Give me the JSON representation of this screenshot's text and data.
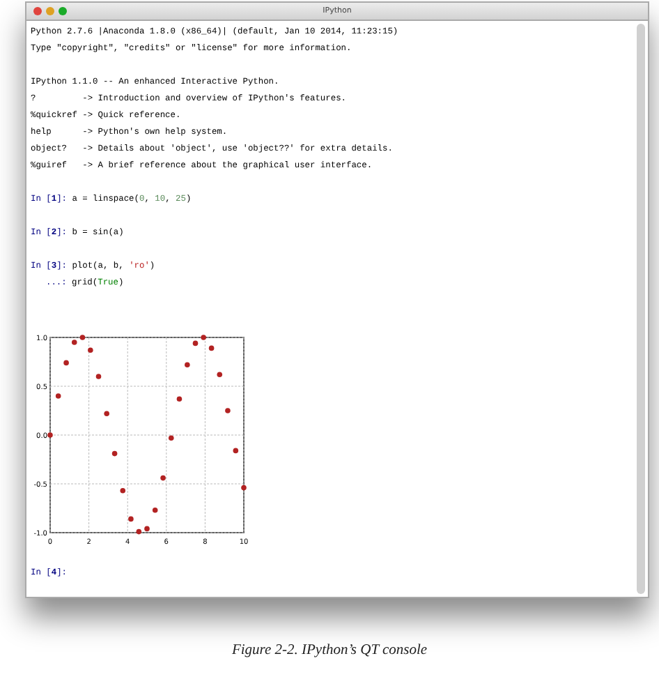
{
  "window": {
    "title": "IPython"
  },
  "banner": [
    [
      "Python 2.7.6 |Anaconda 1.8.0 (x86_64)| (default, Jan 10 2014, 11:23:15)",
      "Type \"copyright\", \"credits\" or \"license\" for more information."
    ],
    [
      "IPython 1.1.0 -- An enhanced Interactive Python.",
      "?         -> Introduction and overview of IPython's features.",
      "%quickref -> Quick reference.",
      "help      -> Python's own help system.",
      "object?   -> Details about 'object', use 'object??' for extra details.",
      "%guiref   -> A brief reference about the graphical user interface."
    ]
  ],
  "cells": [
    {
      "lines": [
        {
          "prompt": "In [**1**]:",
          "kind": "input",
          "code": [
            {
              "t": "a = linspace(",
              "kind": "plain"
            },
            {
              "t": "0",
              "kind": "number"
            },
            {
              "t": ", ",
              "kind": "plain"
            },
            {
              "t": "10",
              "kind": "number"
            },
            {
              "t": ", ",
              "kind": "plain"
            },
            {
              "t": "25",
              "kind": "number"
            },
            {
              "t": ")",
              "kind": "plain"
            }
          ]
        }
      ]
    },
    {
      "lines": [
        {
          "prompt": "In [**2**]:",
          "kind": "input",
          "code": [
            {
              "t": "b = sin(a)",
              "kind": "plain"
            }
          ]
        }
      ]
    },
    {
      "lines": [
        {
          "prompt": "In [**3**]:",
          "kind": "input",
          "code": [
            {
              "t": "plot(a, b, ",
              "kind": "plain"
            },
            {
              "t": "'ro'",
              "kind": "string"
            },
            {
              "t": ")",
              "kind": "plain"
            }
          ]
        },
        {
          "prompt": "...:",
          "kind": "continuation",
          "code": [
            {
              "t": "grid(",
              "kind": "plain"
            },
            {
              "t": "True",
              "kind": "builtin"
            },
            {
              "t": ")",
              "kind": "plain"
            }
          ]
        }
      ],
      "chart_data": {
        "type": "scatter",
        "grid": true,
        "x": [
          0,
          0.42,
          0.83,
          1.25,
          1.67,
          2.08,
          2.5,
          2.92,
          3.33,
          3.75,
          4.17,
          4.58,
          5,
          5.42,
          5.83,
          6.25,
          6.67,
          7.08,
          7.5,
          7.92,
          8.33,
          8.75,
          9.17,
          9.58,
          10
        ],
        "series": [
          {
            "color": "#b22222",
            "values": [
              0,
              0.4,
              0.74,
              0.95,
              1.0,
              0.87,
              0.6,
              0.22,
              -0.19,
              -0.57,
              -0.86,
              -0.99,
              -0.96,
              -0.77,
              -0.44,
              -0.03,
              0.37,
              0.72,
              0.94,
              1.0,
              0.89,
              0.62,
              0.25,
              -0.16,
              -0.54
            ]
          }
        ],
        "xlim": [
          0,
          10
        ],
        "ylim": [
          -1,
          1
        ],
        "xticks": [
          0,
          2,
          4,
          6,
          8,
          10
        ],
        "yticks": [
          {
            "value": -1,
            "label": "-1.0"
          },
          {
            "value": -0.5,
            "label": "-0.5"
          },
          {
            "value": 0,
            "label": "0.0"
          },
          {
            "value": 0.5,
            "label": "0.5"
          },
          {
            "value": 1,
            "label": "1.0"
          }
        ]
      }
    },
    {
      "lines": [
        {
          "prompt": "In [**4**]:",
          "kind": "input"
        }
      ]
    }
  ],
  "caption": "Figure 2-2. IPython’s QT console"
}
